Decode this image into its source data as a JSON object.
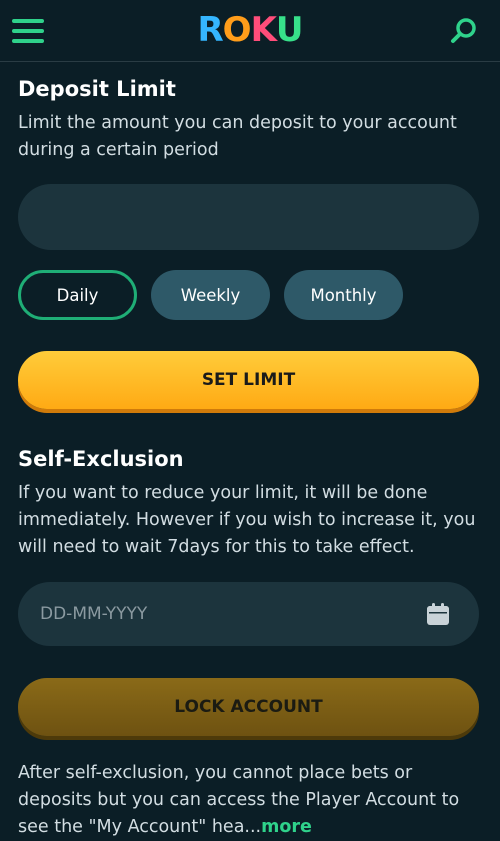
{
  "header": {
    "logo_parts": [
      "R",
      "O",
      "K",
      "U"
    ],
    "menu_icon": "hamburger-menu-icon",
    "search_icon": "search-icon",
    "accent_color": "#2fd28b"
  },
  "deposit_limit": {
    "title": "Deposit Limit",
    "description": "Limit the amount you can deposit to your account during a certain period",
    "amount_value": "",
    "periods": [
      "Daily",
      "Weekly",
      "Monthly"
    ],
    "selected_period": "Daily",
    "set_button": "SET LIMIT"
  },
  "self_exclusion": {
    "title": "Self-Exclusion",
    "description": "If you want to reduce your limit, it will be done immediately. However if you wish to increase it, you will need to wait 7days for this to take effect.",
    "date_placeholder": "DD-MM-YYYY",
    "calendar_icon": "calendar-icon",
    "lock_button": "LOCK ACCOUNT",
    "footer_text": "After self-exclusion, you cannot place bets or deposits but you can access the Player Account to see the \"My Account\" hea...",
    "more_label": "more"
  }
}
